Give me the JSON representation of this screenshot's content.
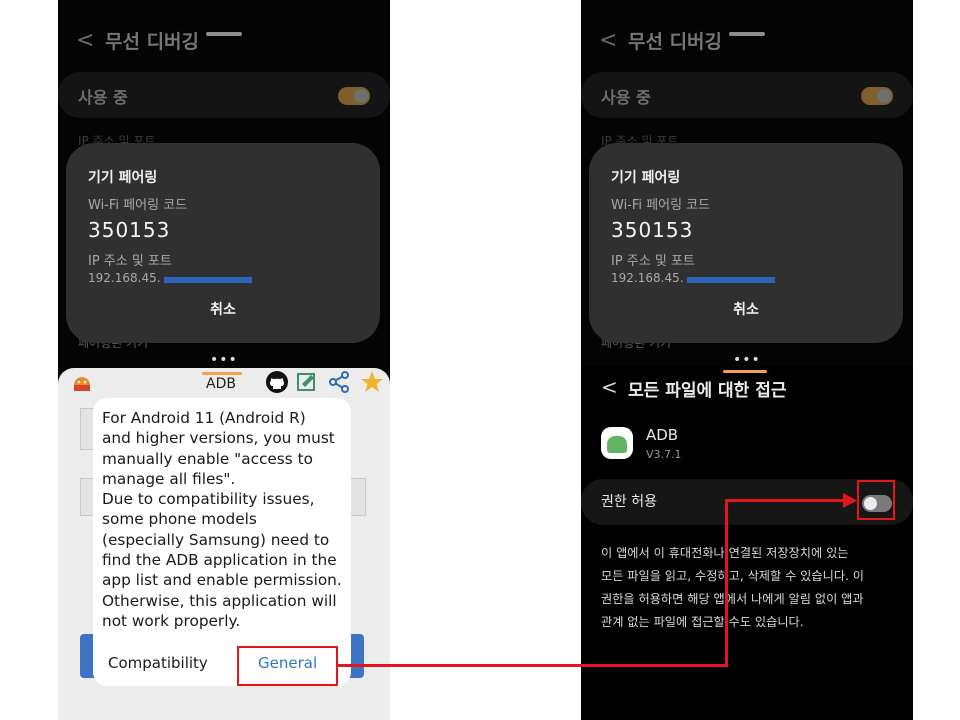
{
  "left_screen": {
    "header": {
      "back": "<",
      "title": "무선 디버깅"
    },
    "in_use_label": "사용 중",
    "ghost_text_top": "IP 주소 및 포트",
    "ghost_text_bottom": "페어링된 기기",
    "pairing_dialog": {
      "title": "기기 페어링",
      "code_label": "Wi-Fi 페어링 코드",
      "code": "350153",
      "ip_label": "IP 주소 및 포트",
      "ip_value": "192.168.45.",
      "cancel": "취소"
    },
    "handle_dots": "•••",
    "app_sheet": {
      "tab_label": "ADB",
      "icons": [
        "android-icon",
        "github-icon",
        "edit-icon",
        "share-icon",
        "star-icon"
      ]
    },
    "message_dialog": {
      "message": "For Android 11 (Android R)\nand higher versions, you must\nmanually enable \"access to\nmanage all files\".\nDue to compatibility issues,\nsome phone models\n(especially Samsung) need to\nfind the ADB application in the\napp list and enable permission.\nOtherwise, this application will\nnot work properly.",
      "compatibility_button": "Compatibility",
      "general_button": "General"
    }
  },
  "right_screen": {
    "header": {
      "back": "<",
      "title": "무선 디버깅"
    },
    "in_use_label": "사용 중",
    "ghost_text_top": "IP 주소 및 포트",
    "ghost_text_bottom": "페어링된 기기",
    "pairing_dialog": {
      "title": "기기 페어링",
      "code_label": "Wi-Fi 페어링 코드",
      "code": "350153",
      "ip_label": "IP 주소 및 포트",
      "ip_value": "192.168.45.",
      "cancel": "취소"
    },
    "handle_dots": "•••",
    "permission_page": {
      "back": "<",
      "title": "모든 파일에 대한 접근",
      "app_name": "ADB",
      "app_version": "V3.7.1",
      "allow_label": "권한 허용",
      "allow_enabled": false,
      "description": "이 앱에서 이 휴대전화나 연결된 저장장치에 있는\n모든 파일을 읽고, 수정하고, 삭제할 수 있습니다. 이\n권한을 허용하면 해당 앱에서 나에게 알림 없이 앱과\n관계 없는 파일에 접근할 수도 있습니다."
    }
  },
  "colors": {
    "highlight": "#e2161b",
    "accent_orange": "#f0a34e",
    "link_blue": "#2b76c7",
    "ip_mask": "#2e63b8"
  }
}
